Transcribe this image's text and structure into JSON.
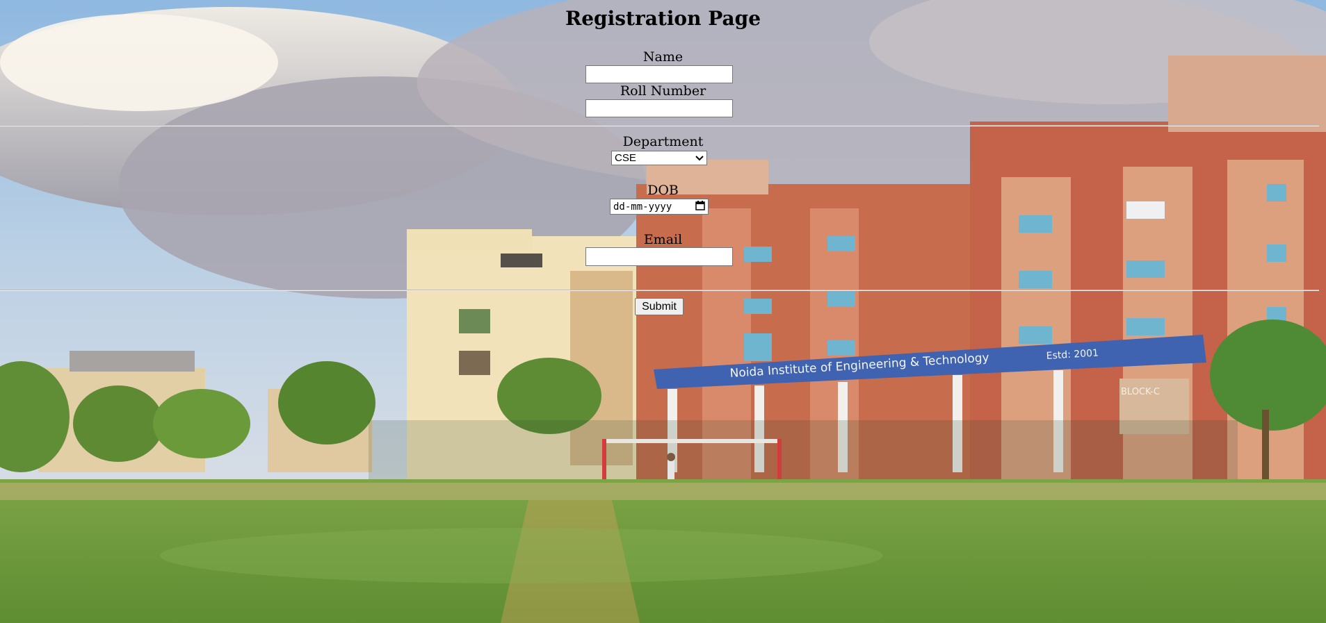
{
  "page": {
    "title": "Registration Page"
  },
  "form": {
    "name_label": "Name",
    "name_value": "",
    "roll_label": "Roll Number",
    "roll_value": "",
    "department_label": "Department",
    "department_selected": "CSE",
    "dob_label": "DOB",
    "dob_placeholder": "dd-mm-yyyy",
    "email_label": "Email",
    "email_value": "",
    "submit_label": "Submit"
  },
  "background": {
    "banner_text": "Noida Institute of Engineering & Technology",
    "estd_text": "Estd: 2001",
    "block_text": "BLOCK-C"
  },
  "colors": {
    "sky": "#a9c9e8",
    "cloud": "#c9c3c6",
    "grass": "#6c9b3c",
    "building_red": "#c86a4c",
    "building_cream": "#f0e4bd",
    "banner_blue": "#3f63b0"
  },
  "icons": {
    "select_arrow": "chevron-down-icon",
    "calendar": "calendar-icon"
  }
}
